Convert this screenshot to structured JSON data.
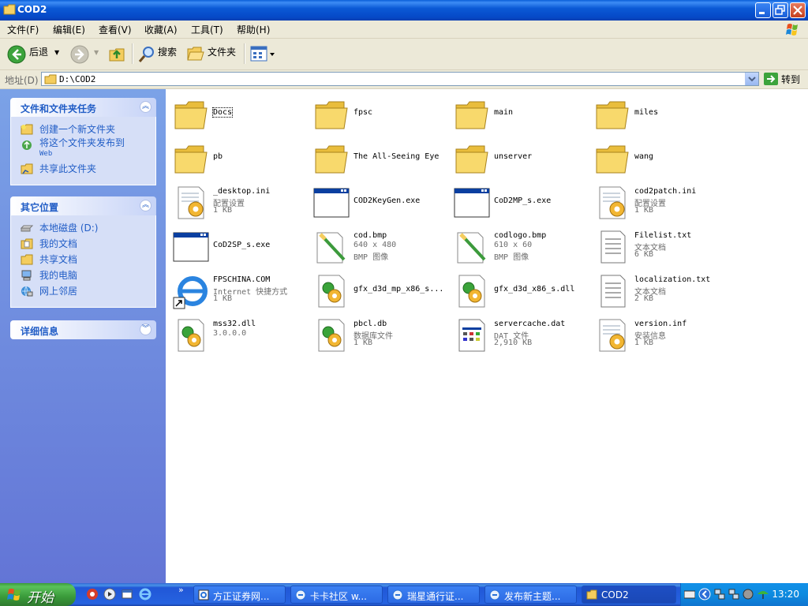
{
  "window": {
    "title": "COD2"
  },
  "menu": [
    {
      "label": "文件(F)"
    },
    {
      "label": "编辑(E)"
    },
    {
      "label": "查看(V)"
    },
    {
      "label": "收藏(A)"
    },
    {
      "label": "工具(T)"
    },
    {
      "label": "帮助(H)"
    }
  ],
  "toolbar": {
    "back": "后退",
    "search": "搜索",
    "folders": "文件夹"
  },
  "address": {
    "label": "地址(D)",
    "value": "D:\\COD2",
    "go": "转到"
  },
  "left_panels": {
    "tasks": {
      "title": "文件和文件夹任务",
      "items": [
        {
          "label": "创建一个新文件夹"
        },
        {
          "label": "将这个文件夹发布到",
          "sub": "Web"
        },
        {
          "label": "共享此文件夹"
        }
      ]
    },
    "places": {
      "title": "其它位置",
      "items": [
        {
          "label": "本地磁盘 (D:)"
        },
        {
          "label": "我的文档"
        },
        {
          "label": "共享文档"
        },
        {
          "label": "我的电脑"
        },
        {
          "label": "网上邻居"
        }
      ]
    },
    "details": {
      "title": "详细信息"
    }
  },
  "files": [
    {
      "name": "Docs",
      "type": "folder"
    },
    {
      "name": "fpsc",
      "type": "folder"
    },
    {
      "name": "main",
      "type": "folder"
    },
    {
      "name": "miles",
      "type": "folder"
    },
    {
      "name": "pb",
      "type": "folder"
    },
    {
      "name": "The All-Seeing Eye",
      "type": "folder"
    },
    {
      "name": "unserver",
      "type": "folder"
    },
    {
      "name": "wang",
      "type": "folder"
    },
    {
      "name": "_desktop.ini",
      "line2": "配置设置",
      "line3": "1 KB",
      "type": "ini"
    },
    {
      "name": "COD2KeyGen.exe",
      "type": "exe"
    },
    {
      "name": "CoD2MP_s.exe",
      "type": "exe"
    },
    {
      "name": "cod2patch.ini",
      "line2": "配置设置",
      "line3": "1 KB",
      "type": "ini"
    },
    {
      "name": "CoD2SP_s.exe",
      "type": "exe"
    },
    {
      "name": "cod.bmp",
      "line2": "640 x 480",
      "line3": "BMP 图像",
      "type": "bmp"
    },
    {
      "name": "codlogo.bmp",
      "line2": "610 x 60",
      "line3": "BMP 图像",
      "type": "bmp"
    },
    {
      "name": "Filelist.txt",
      "line2": "文本文档",
      "line3": "6 KB",
      "type": "txt"
    },
    {
      "name": "FPSCHINA.COM",
      "line2": "Internet 快捷方式",
      "line3": "1 KB",
      "type": "url"
    },
    {
      "name": "gfx_d3d_mp_x86_s...",
      "type": "dll"
    },
    {
      "name": "gfx_d3d_x86_s.dll",
      "type": "dll"
    },
    {
      "name": "localization.txt",
      "line2": "文本文档",
      "line3": "2 KB",
      "type": "txt"
    },
    {
      "name": "mss32.dll",
      "line2": "3.0.0.0",
      "type": "dll"
    },
    {
      "name": "pbcl.db",
      "line2": "数据库文件",
      "line3": "1 KB",
      "type": "dll"
    },
    {
      "name": "servercache.dat",
      "line2": "DAT 文件",
      "line3": "2,910 KB",
      "type": "dat"
    },
    {
      "name": "version.inf",
      "line2": "安装信息",
      "line3": "1 KB",
      "type": "ini"
    }
  ],
  "taskbar": {
    "start": "开始",
    "items": [
      {
        "label": "方正证券网..."
      },
      {
        "label": "卡卡社区 w..."
      },
      {
        "label": "瑞星通行证..."
      },
      {
        "label": "发布新主题..."
      },
      {
        "label": "COD2"
      }
    ],
    "clock": "13:20"
  }
}
